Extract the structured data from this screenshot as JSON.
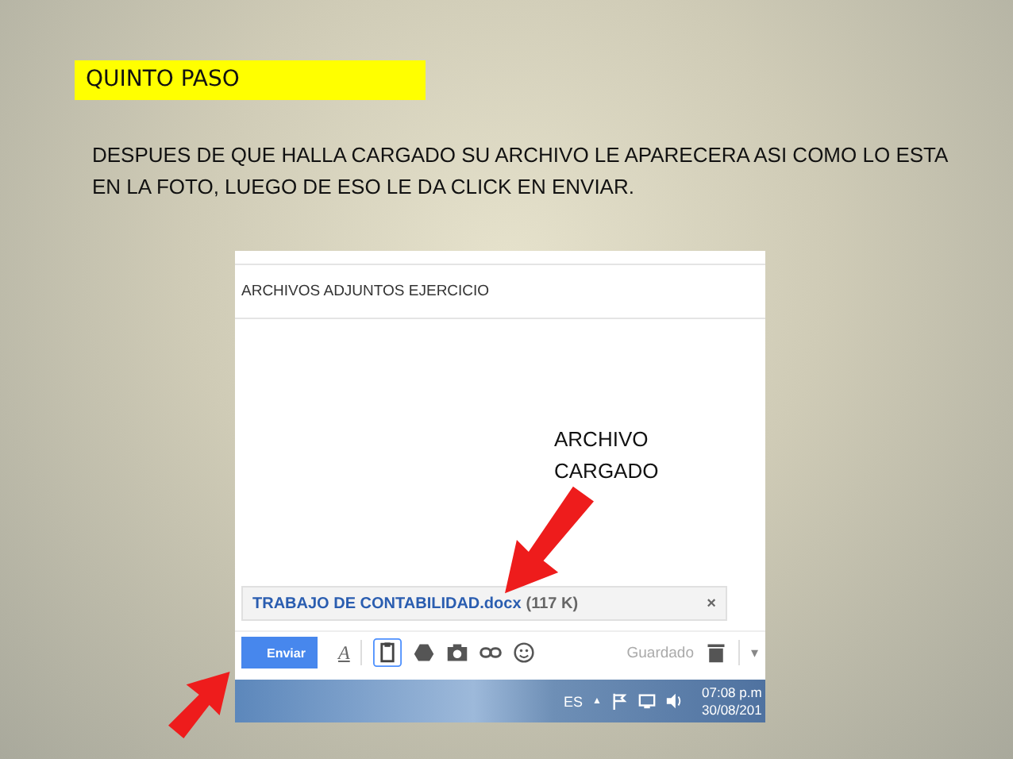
{
  "step_title": "QUINTO PASO",
  "instruction": "DESPUES DE QUE HALLA CARGADO SU ARCHIVO LE APARECERA ASI COMO LO ESTA EN LA FOTO, LUEGO DE ESO LE DA CLICK EN ENVIAR.",
  "screenshot": {
    "subject": "ARCHIVOS ADJUNTOS EJERCICIO",
    "callout": "ARCHIVO CARGADO",
    "attachment": {
      "name": "TRABAJO DE CONTABILIDAD.docx",
      "size": "(117 K)",
      "close": "×"
    },
    "toolbar": {
      "send": "Enviar",
      "format": "A",
      "status": "Guardado",
      "more": "▾"
    },
    "taskbar": {
      "language": "ES",
      "tray_arrow": "▲",
      "time": "07:08 p.m",
      "date": "30/08/201"
    }
  }
}
